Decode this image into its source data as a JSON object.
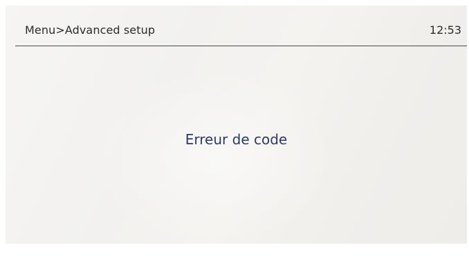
{
  "header": {
    "breadcrumb": "Menu>Advanced setup",
    "time": "12:53"
  },
  "dialog": {
    "message": "Erreur de code"
  },
  "colors": {
    "message_text": "#2a3a66",
    "header_text": "#2b2b2b",
    "divider": "#4a4a4a"
  }
}
